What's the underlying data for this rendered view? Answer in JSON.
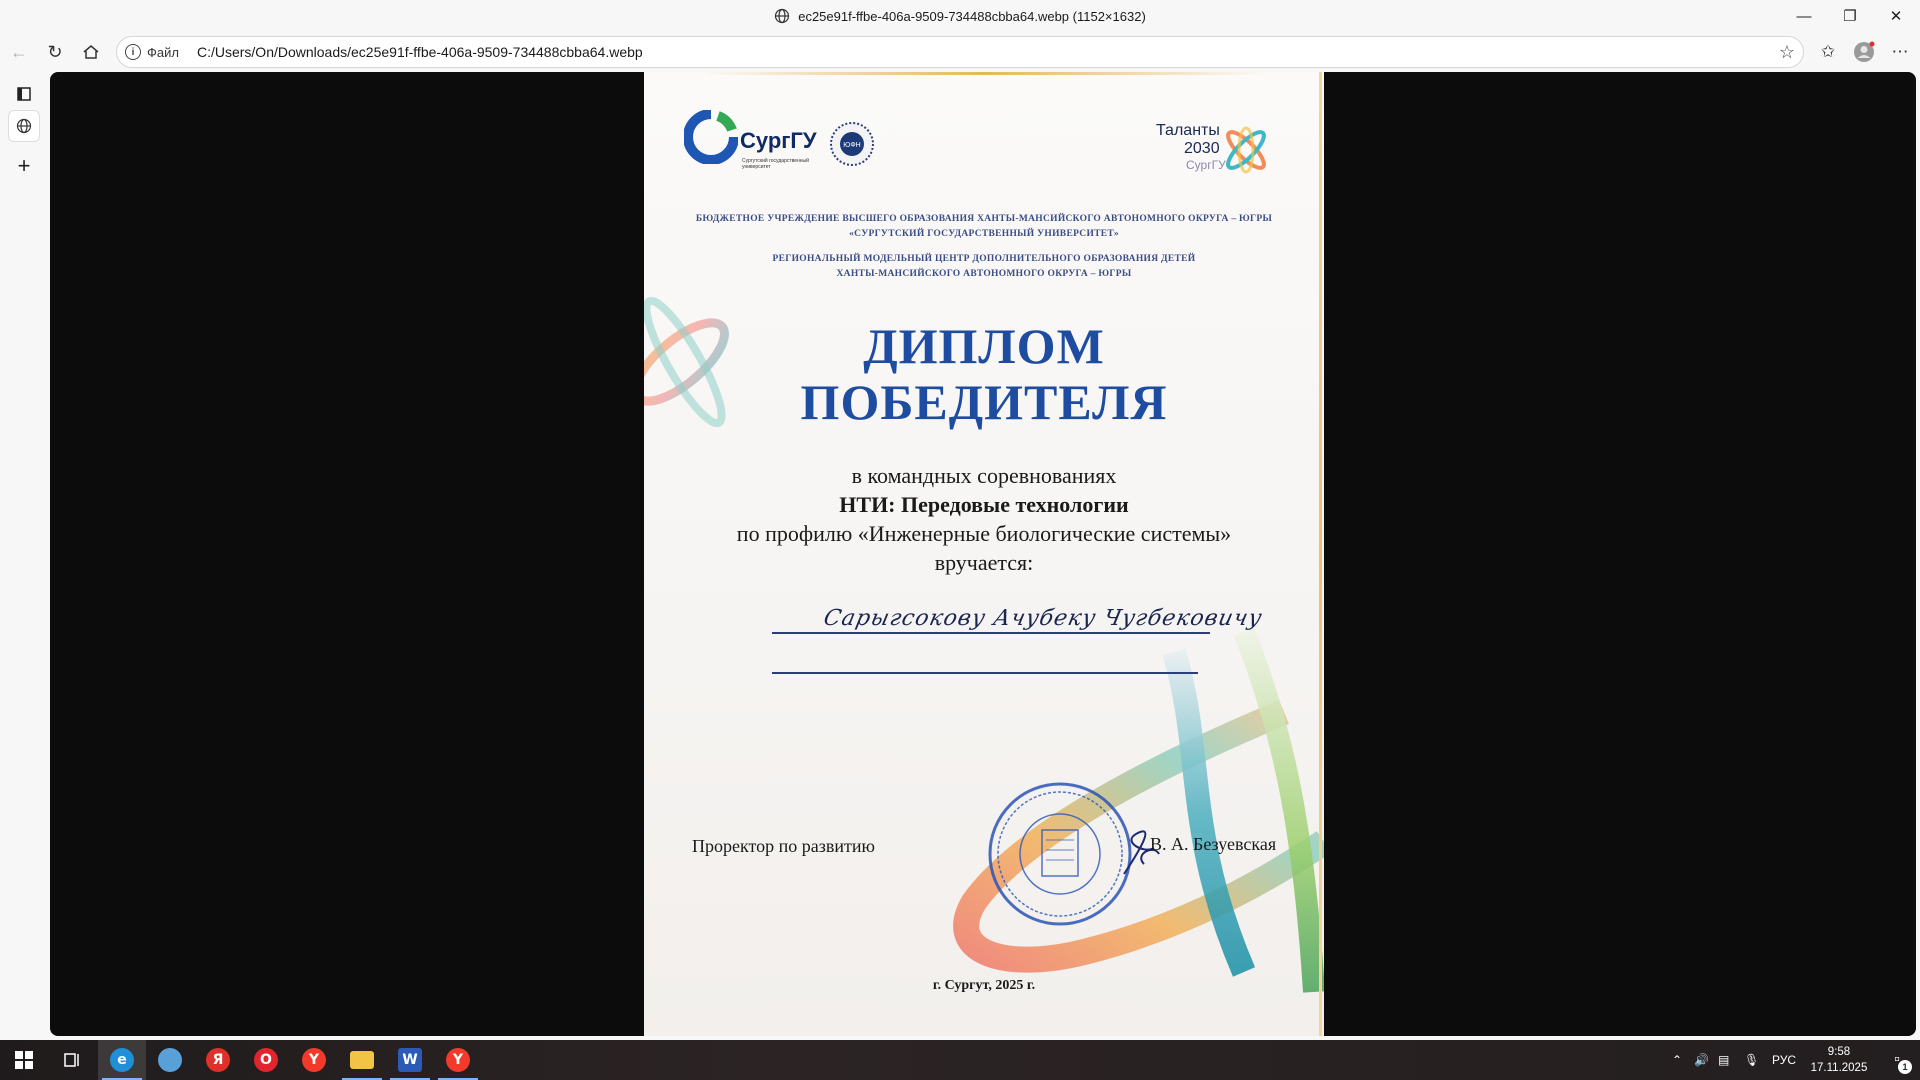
{
  "window": {
    "title": "ec25e91f-ffbe-406a-9509-734488cbba64.webp (1152×1632)"
  },
  "addressbar": {
    "scheme_label": "Файл",
    "url": "C:/Users/On/Downloads/ec25e91f-ffbe-406a-9509-734488cbba64.webp"
  },
  "document": {
    "logo_name": "СургГУ",
    "logo_subtitle": "Сургутский государственный университет",
    "emblem_text": "ЮФН",
    "talanty_name": "Таланты",
    "talanty_year": "2030",
    "talanty_sub": "СургГУ",
    "header_lines": [
      "Бюджетное учреждение высшего образования Ханты-Мансийского автономного округа – Югры",
      "«Сургутский государственный университет»",
      "Региональный модельный центр дополнительного образования детей",
      "Ханты-Мансийского автономного округа – Югры"
    ],
    "title_line1": "ДИПЛОМ",
    "title_line2": "ПОБЕДИТЕЛЯ",
    "body_lines": [
      "в командных соревнованиях",
      "НТИ: Передовые технологии",
      "по профилю «Инженерные биологические системы»",
      "вручается:"
    ],
    "recipient_handwritten": "Сарыгсокову Ачубеку Чугбековичу",
    "signer_role": "Проректор по развитию",
    "signer_name": "В. А. Безуевская",
    "place_year": "г. Сургут, 2025 г."
  },
  "taskbar": {
    "apps": [
      {
        "name": "edge",
        "letter": "e",
        "color": "#1f8fd8",
        "active": true
      },
      {
        "name": "app-2",
        "letter": "",
        "color": "#5aa0d8",
        "active": false
      },
      {
        "name": "yandex-browser",
        "letter": "Я",
        "color": "#e0302a",
        "active": false
      },
      {
        "name": "opera",
        "letter": "O",
        "color": "#e0252f",
        "active": false
      },
      {
        "name": "yandex",
        "letter": "Y",
        "color": "#f33a2a",
        "active": false
      },
      {
        "name": "file-explorer",
        "letter": "",
        "color": "#f2c445",
        "active": true
      },
      {
        "name": "word",
        "letter": "W",
        "color": "#2b5ab7",
        "active": true
      },
      {
        "name": "yandex-2",
        "letter": "Y",
        "color": "#f33a2a",
        "active": true
      }
    ],
    "language": "РУС",
    "time": "9:58",
    "date": "17.11.2025",
    "notification_count": "1"
  }
}
